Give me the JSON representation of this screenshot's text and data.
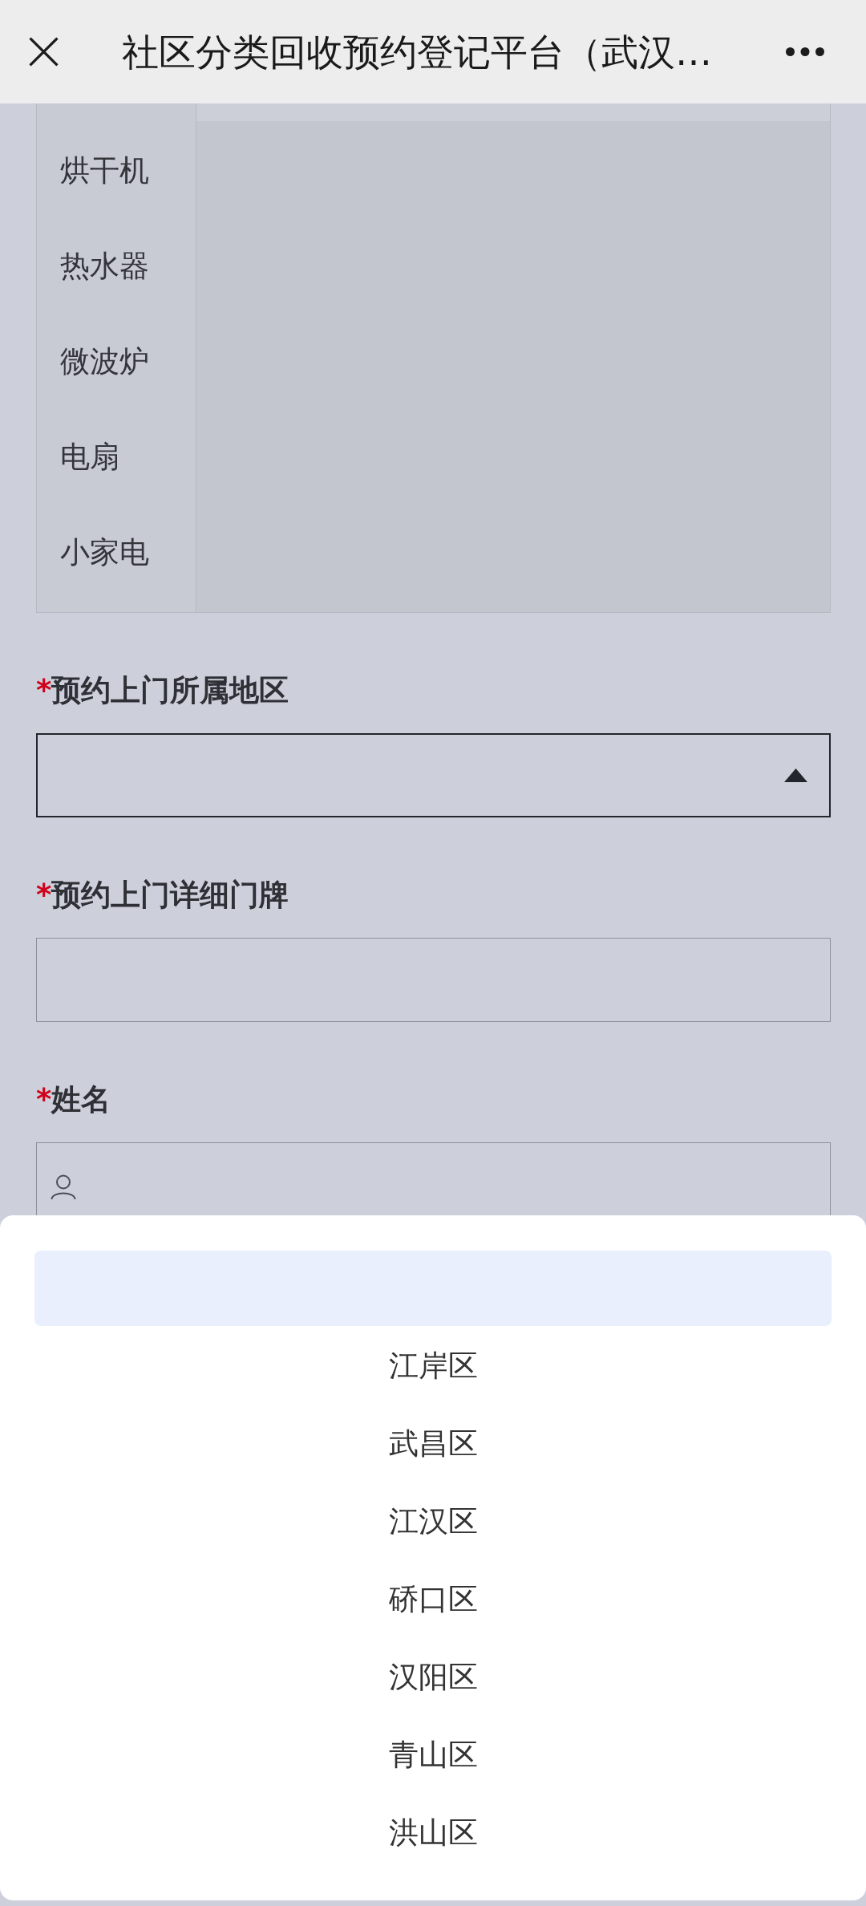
{
  "top_bar": {
    "title": "社区分类回收预约登记平台（武汉…"
  },
  "category_list": {
    "items": [
      "烘干机",
      "热水器",
      "微波炉",
      "电扇",
      "小家电"
    ]
  },
  "form_fields": [
    {
      "kind": "select",
      "marker": "*",
      "label": "预约上门所属地区",
      "expanded": true
    },
    {
      "kind": "text",
      "marker": "*",
      "label": "预约上门详细门牌"
    },
    {
      "kind": "person",
      "marker": "*",
      "label": "姓名"
    }
  ],
  "dropdown": {
    "options": [
      {
        "selected": true
      },
      {
        "label": "江岸区",
        "selected": false
      },
      {
        "label": "武昌区",
        "selected": false
      },
      {
        "label": "江汉区",
        "selected": false
      },
      {
        "label": "硚口区",
        "selected": false
      },
      {
        "label": "汉阳区",
        "selected": false
      },
      {
        "label": "青山区",
        "selected": false
      },
      {
        "label": "洪山区",
        "selected": false
      }
    ]
  }
}
